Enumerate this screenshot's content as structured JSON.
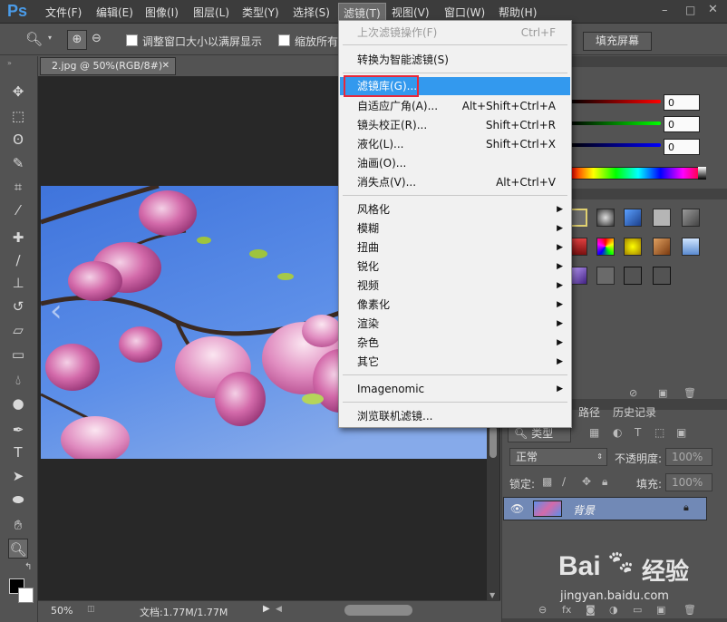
{
  "app": {
    "logo": "Ps"
  },
  "menubar": {
    "items": [
      "文件(F)",
      "编辑(E)",
      "图像(I)",
      "图层(L)",
      "类型(Y)",
      "选择(S)",
      "滤镜(T)",
      "视图(V)",
      "窗口(W)",
      "帮助(H)"
    ]
  },
  "options": {
    "resize_window_label": "调整窗口大小以满屏显示",
    "zoom_all_label": "缩放所有",
    "fill_screen_label": "填充屏幕"
  },
  "document": {
    "tab_title": "2.jpg @ 50%(RGB/8#)",
    "zoom": "50%",
    "doc_info": "文档:1.77M/1.77M"
  },
  "filter_menu": {
    "last_filter": {
      "label": "上次滤镜操作(F)",
      "shortcut": "Ctrl+F"
    },
    "smart_filter": "转换为智能滤镜(S)",
    "gallery": "滤镜库(G)...",
    "adaptive_wide": {
      "label": "自适应广角(A)...",
      "shortcut": "Alt+Shift+Ctrl+A"
    },
    "lens_correction": {
      "label": "镜头校正(R)...",
      "shortcut": "Shift+Ctrl+R"
    },
    "liquify": {
      "label": "液化(L)...",
      "shortcut": "Shift+Ctrl+X"
    },
    "oil_paint": "油画(O)...",
    "vanishing_point": {
      "label": "消失点(V)...",
      "shortcut": "Alt+Ctrl+V"
    },
    "submenus": [
      "风格化",
      "模糊",
      "扭曲",
      "锐化",
      "视频",
      "像素化",
      "渲染",
      "杂色",
      "其它"
    ],
    "imagenomic": "Imagenomic",
    "browse_online": "浏览联机滤镜..."
  },
  "color_panel": {
    "r": "0",
    "g": "0",
    "b": "0"
  },
  "layers_panel": {
    "tabs": [
      "路径",
      "历史记录"
    ],
    "kind_label": "类型",
    "blend_mode": "正常",
    "opacity_label": "不透明度:",
    "opacity": "100%",
    "lock_label": "锁定:",
    "fill_label": "填充:",
    "fill": "100%",
    "layer_name": "背景"
  },
  "watermark": {
    "brand": "Bai",
    "brand2": "经验",
    "url": "jingyan.baidu.com"
  },
  "colors": {
    "accent": "#3399ee",
    "highlight_box": "#e8283a",
    "menubar": "#3c3c3c",
    "panel": "#535353"
  }
}
